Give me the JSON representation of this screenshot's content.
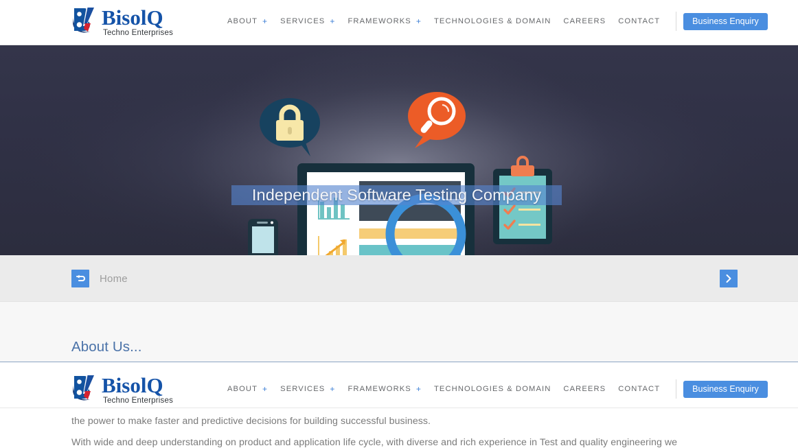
{
  "header": {
    "logo": {
      "name": "BisolQ",
      "tagline": "Techno Enterprises",
      "mark_icon": "bisolq-b-swoosh-logo-icon"
    },
    "nav": [
      {
        "label": "ABOUT",
        "has_plus": true
      },
      {
        "label": "SERVICES",
        "has_plus": true
      },
      {
        "label": "FRAMEWORKS",
        "has_plus": true
      },
      {
        "label": "TECHNOLOGIES & DOMAIN",
        "has_plus": false
      },
      {
        "label": "CAREERS",
        "has_plus": false
      },
      {
        "label": "CONTACT",
        "has_plus": false
      }
    ],
    "plus_symbol": "+",
    "enquiry_button": "Business Enquiry",
    "accent_blue": "#4a8ee0",
    "logo_blue": "#1553a8"
  },
  "hero": {
    "caption": "Independent Software Testing Company",
    "background_color": "#2e2f3e",
    "caption_highlight_color": "#5684ce",
    "art": {
      "lock_bubble_icon": "padlock-speech-bubble-icon",
      "lock_bubble_color": "#17425f",
      "lock_color": "#f7e7a8",
      "search_bubble_icon": "magnifier-speech-bubble-icon",
      "search_bubble_color": "#ec5c27",
      "monitor_icon": "desktop-monitor-icon",
      "monitor_frame_color": "#1b2f3a",
      "magnifier_icon": "magnifying-glass-icon",
      "magnifier_color": "#3b90d8",
      "clipboard_icon": "checklist-clipboard-icon",
      "clipboard_color": "#74c8c6",
      "clip_color": "#ef7d50",
      "phone_icon": "smartphone-icon",
      "bar_chart_color": "#6fc3c3",
      "line_chart_color": "#f4c96b"
    }
  },
  "breadcrumb": {
    "home_label": "Home",
    "home_icon": "return-arrow-icon",
    "next_icon": "chevron-right-icon",
    "bar_color": "#ebebeb"
  },
  "about": {
    "title": "About Us...",
    "title_color": "#4a72a8",
    "paragraphs": [
      "the power to make faster and predictive decisions for building successful business.",
      "With wide and deep understanding on product and application life cycle, with diverse and rich experience in Test and quality engineering we"
    ]
  }
}
